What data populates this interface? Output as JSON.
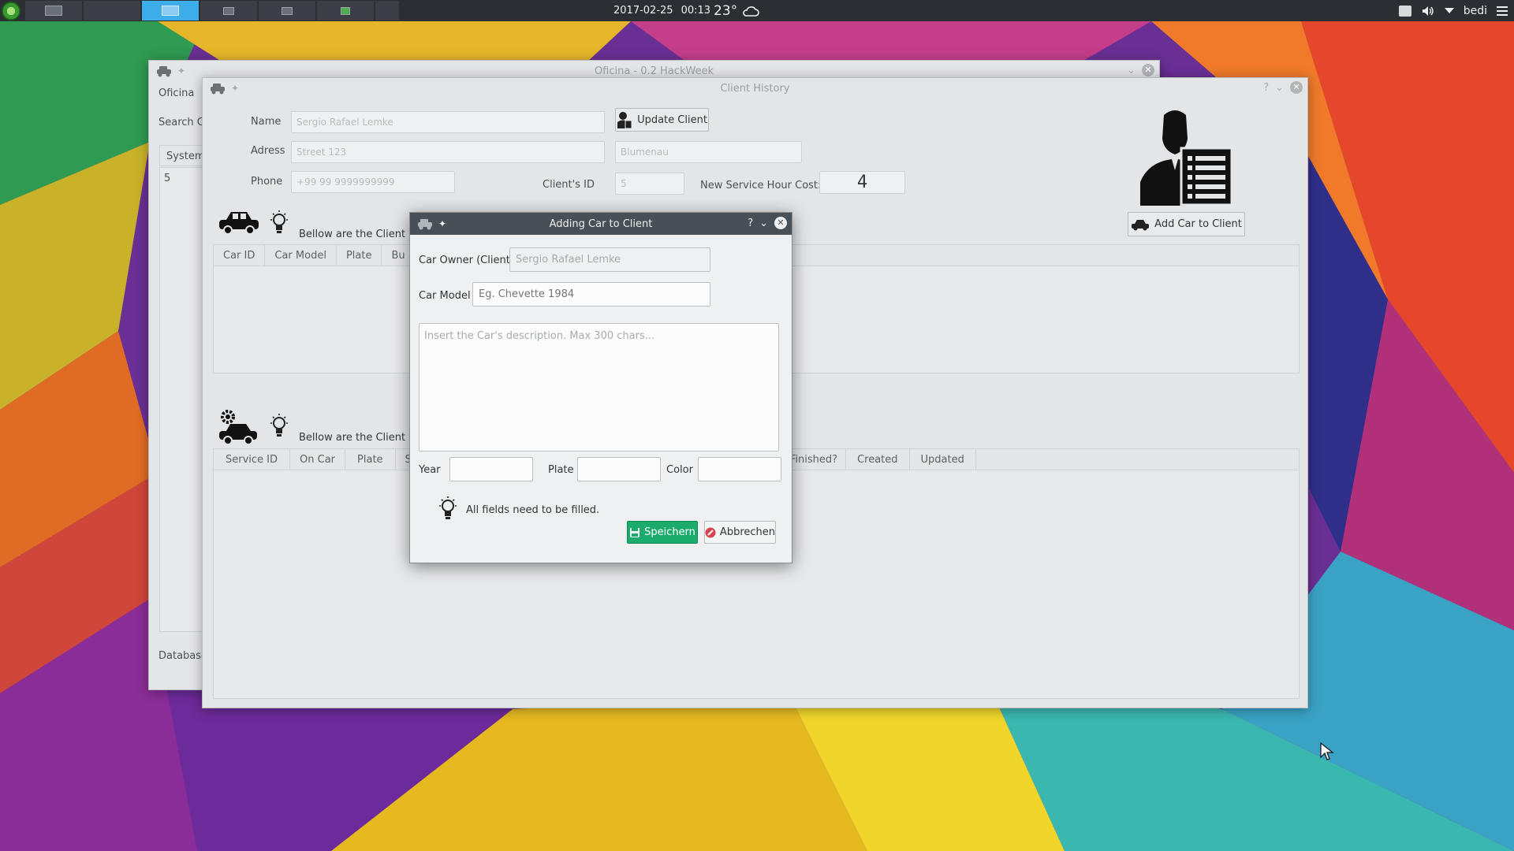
{
  "taskbar": {
    "date": "2017-02-25",
    "time": "00:13",
    "temperature": "23°",
    "user": "bedi"
  },
  "main_window": {
    "title": "Oficina - 0.2 HackWeek",
    "side_label": "Oficina",
    "search_label": "Search Cli",
    "tab_label": "System",
    "list_value": "5",
    "database_label": "Database"
  },
  "client_window": {
    "title": "Client History",
    "name_label": "Name",
    "name_value": "Sergio Rafael Lemke",
    "address_label": "Adress",
    "street_value": "Street 123",
    "city_value": "Blumenau",
    "phone_label": "Phone",
    "phone_value": "+99 99 9999999999",
    "client_id_label": "Client's ID",
    "client_id_value": "5",
    "hour_cost_label": "New Service Hour Cost:",
    "hour_cost_value": "4",
    "update_button": "Update Client",
    "add_car_button": "Add Car to Client",
    "cars_hint": "Bellow are the Client Ca",
    "cars_columns": [
      "Car ID",
      "Car Model",
      "Plate",
      "Bu"
    ],
    "services_hint": "Bellow are the Client Ser",
    "services_columns_left": [
      "Service ID",
      "On Car",
      "Plate",
      "St"
    ],
    "services_columns_right": [
      "Finished?",
      "Created",
      "Updated"
    ]
  },
  "dialog": {
    "title": "Adding Car to Client",
    "owner_label": "Car Owner (Client)",
    "owner_value": "Sergio Rafael Lemke",
    "model_label": "Car Model",
    "model_placeholder": "Eg. Chevette 1984",
    "description_placeholder": "Insert the Car's description. Max 300 chars...",
    "year_label": "Year",
    "plate_label": "Plate",
    "color_label": "Color",
    "hint": "All fields need to be filled.",
    "save_button": "Speichern",
    "cancel_button": "Abbrechen"
  },
  "colors": {
    "accent": "#3daee9",
    "save": "#1bab6c",
    "titlebar_dark": "#475057",
    "cancel_icon": "#da4453"
  }
}
